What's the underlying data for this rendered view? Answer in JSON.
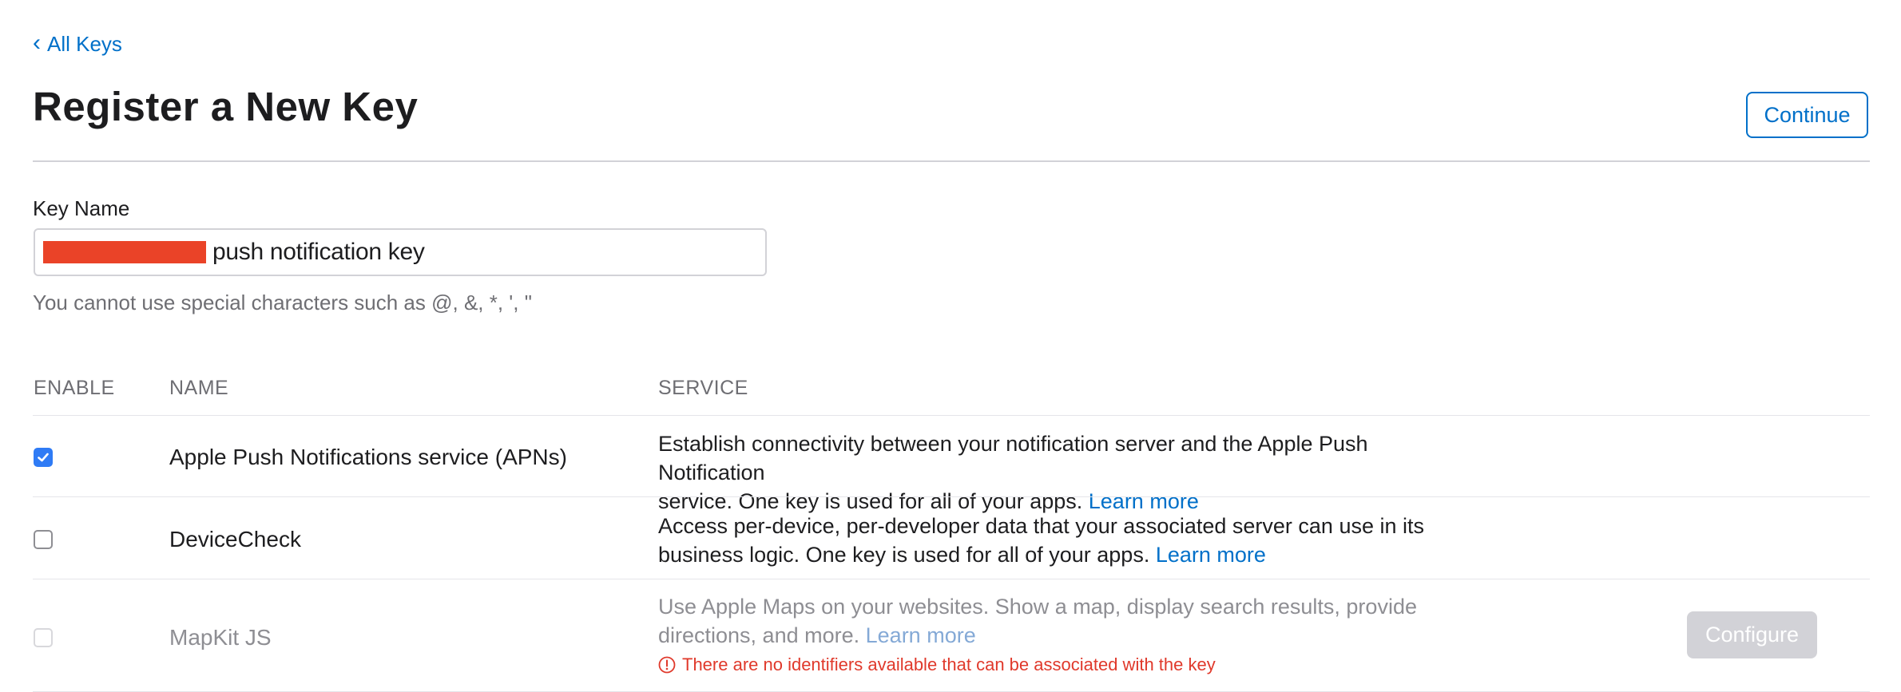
{
  "nav": {
    "back_label": "All Keys"
  },
  "header": {
    "title": "Register a New Key",
    "continue_label": "Continue"
  },
  "key_field": {
    "label": "Key Name",
    "value": "push notification key",
    "hint": "You cannot use special characters such as @, &, *, ', \""
  },
  "table": {
    "headers": {
      "enable": "ENABLE",
      "name": "NAME",
      "service": "SERVICE"
    },
    "rows": [
      {
        "name": "Apple Push Notifications service (APNs)",
        "enabled": true,
        "desc_line1": "Establish connectivity between your notification server and the Apple Push Notification",
        "desc_line2": "service. One key is used for all of your apps.",
        "link": "Learn more"
      },
      {
        "name": "DeviceCheck",
        "enabled": false,
        "desc_line1": "Access per-device, per-developer data that your associated server can use in its",
        "desc_line2": "business logic. One key is used for all of your apps.",
        "link": "Learn more"
      },
      {
        "name": "MapKit JS",
        "enabled": false,
        "disabled": true,
        "desc_line1": "Use Apple Maps on your websites. Show a map, display search results, provide",
        "desc_line2": "directions, and more.",
        "link": "Learn more",
        "error": "There are no identifiers available that can be associated with the key",
        "configure_label": "Configure"
      }
    ]
  },
  "colors": {
    "accent": "#0070c9",
    "checkbox_checked": "#2f7bf5",
    "error": "#e0392b",
    "redaction": "#ea4328"
  },
  "icons": {
    "back": "chevron-left-icon",
    "check": "checkmark-icon",
    "error": "exclamation-circle-icon"
  }
}
